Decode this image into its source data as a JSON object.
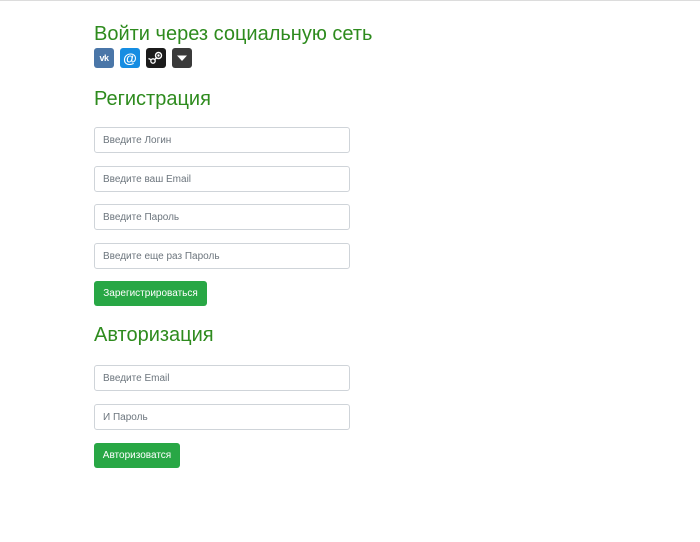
{
  "social": {
    "title": "Войти через социальную сеть",
    "providers": [
      {
        "icon": "vk-icon",
        "glyph": "vk",
        "color": "#4a76a8"
      },
      {
        "icon": "mailru-icon",
        "glyph": "@",
        "color": "#168de2"
      },
      {
        "icon": "steam-icon",
        "color": "#1b1b1b"
      },
      {
        "icon": "more-dropdown-icon",
        "color": "#3a3a3a"
      }
    ]
  },
  "registration": {
    "title": "Регистрация",
    "login_placeholder": "Введите Логин",
    "email_placeholder": "Введите ваш Email",
    "password_placeholder": "Введите Пароль",
    "password_repeat_placeholder": "Введите еще раз Пароль",
    "submit_label": "Зарегистрироваться"
  },
  "authorization": {
    "title": "Авторизация",
    "email_placeholder": "Введите Email",
    "password_placeholder": "И Пароль",
    "submit_label": "Авторизоватся"
  },
  "colors": {
    "heading": "#2e8b1e",
    "button": "#28a745"
  }
}
